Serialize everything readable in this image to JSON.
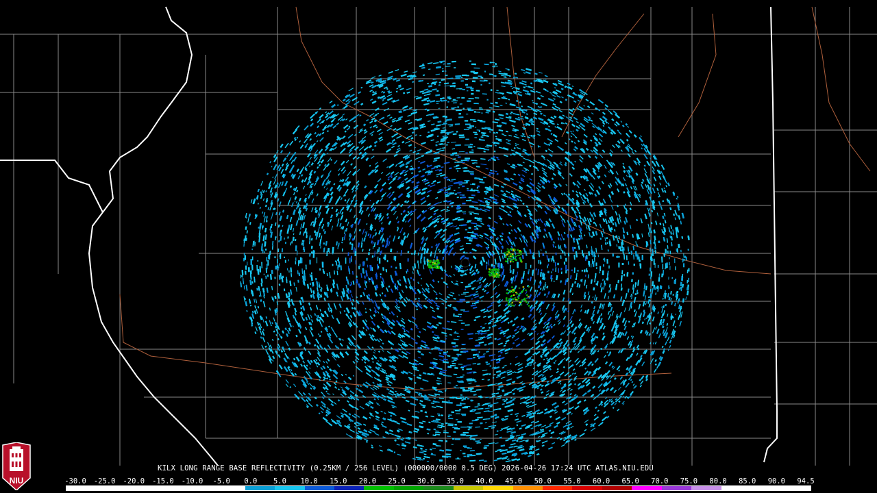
{
  "caption": "KILX LONG RANGE BASE REFLECTIVITY (0.25KM / 256 LEVEL) (000000/0000 0.5 DEG) 2026-04-26 17:24 UTC  ATLAS.NIU.EDU",
  "logo_text": "NIU",
  "colors": {
    "background": "#000000",
    "state_border": "#ffffff",
    "county_border": "#8a8a8a",
    "river": "#b0603c",
    "radar_site": "#000000"
  },
  "scale": {
    "ticks": [
      "-30.0",
      "-25.0",
      "-20.0",
      "-15.0",
      "-10.0",
      "-5.0",
      "0.0",
      "5.0",
      "10.0",
      "15.0",
      "20.0",
      "25.0",
      "30.0",
      "35.0",
      "40.0",
      "45.0",
      "50.0",
      "55.0",
      "60.0",
      "65.0",
      "70.0",
      "75.0",
      "80.0",
      "85.0",
      "90.0",
      "94.5"
    ],
    "colors": [
      "#ffffff",
      "#ffffff",
      "#ffffff",
      "#ffffff",
      "#ffffff",
      "#ffffff",
      "#0a9fd6",
      "#18c6f0",
      "#0c5ad8",
      "#0a22b8",
      "#00c000",
      "#00a400",
      "#1c8a1c",
      "#c8c800",
      "#ffd800",
      "#ff9000",
      "#ff2800",
      "#d80000",
      "#b00000",
      "#ff00ff",
      "#9a38d8",
      "#c890e8",
      "#ffffff",
      "#ffffff",
      "#ffffff"
    ]
  },
  "icons": {
    "logo": "niu-tower-logo",
    "radar_site": "radar-site-dot"
  }
}
